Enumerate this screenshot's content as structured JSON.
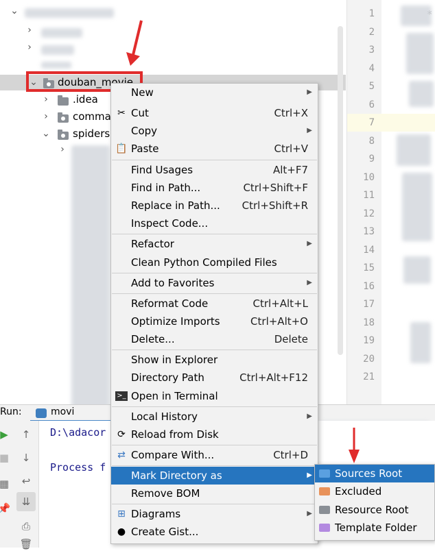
{
  "tree": {
    "selected_folder": "douban_movie",
    "children": [
      ".idea",
      "comma",
      "spiders"
    ]
  },
  "editor": {
    "line_numbers": [
      "1",
      "2",
      "3",
      "4",
      "5",
      "6",
      "7",
      "8",
      "9",
      "10",
      "11",
      "12",
      "13",
      "14",
      "15",
      "16",
      "17",
      "18",
      "19",
      "20",
      "21"
    ],
    "asterisk": "*"
  },
  "run": {
    "label": "Run:",
    "tab": "movi",
    "console_path": "D:\\adacor",
    "console_process": "Process f"
  },
  "context_menu": {
    "items": [
      {
        "label": "New",
        "shortcut": "",
        "submenu": true,
        "icon": ""
      },
      {
        "label": "Cut",
        "shortcut": "Ctrl+X",
        "submenu": false,
        "icon": "scissors-icon"
      },
      {
        "label": "Copy",
        "shortcut": "",
        "submenu": true,
        "icon": ""
      },
      {
        "label": "Paste",
        "shortcut": "Ctrl+V",
        "submenu": false,
        "icon": "clipboard-icon"
      },
      {
        "label": "Find Usages",
        "shortcut": "Alt+F7",
        "submenu": false,
        "icon": ""
      },
      {
        "label": "Find in Path...",
        "shortcut": "Ctrl+Shift+F",
        "submenu": false,
        "icon": ""
      },
      {
        "label": "Replace in Path...",
        "shortcut": "Ctrl+Shift+R",
        "submenu": false,
        "icon": ""
      },
      {
        "label": "Inspect Code...",
        "shortcut": "",
        "submenu": false,
        "icon": ""
      },
      {
        "label": "Refactor",
        "shortcut": "",
        "submenu": true,
        "icon": ""
      },
      {
        "label": "Clean Python Compiled Files",
        "shortcut": "",
        "submenu": false,
        "icon": ""
      },
      {
        "label": "Add to Favorites",
        "shortcut": "",
        "submenu": true,
        "icon": ""
      },
      {
        "label": "Reformat Code",
        "shortcut": "Ctrl+Alt+L",
        "submenu": false,
        "icon": ""
      },
      {
        "label": "Optimize Imports",
        "shortcut": "Ctrl+Alt+O",
        "submenu": false,
        "icon": ""
      },
      {
        "label": "Delete...",
        "shortcut": "Delete",
        "submenu": false,
        "icon": ""
      },
      {
        "label": "Show in Explorer",
        "shortcut": "",
        "submenu": false,
        "icon": ""
      },
      {
        "label": "Directory Path",
        "shortcut": "Ctrl+Alt+F12",
        "submenu": false,
        "icon": ""
      },
      {
        "label": "Open in Terminal",
        "shortcut": "",
        "submenu": false,
        "icon": "terminal-icon"
      },
      {
        "label": "Local History",
        "shortcut": "",
        "submenu": true,
        "icon": ""
      },
      {
        "label": "Reload from Disk",
        "shortcut": "",
        "submenu": false,
        "icon": "reload-icon"
      },
      {
        "label": "Compare With...",
        "shortcut": "Ctrl+D",
        "submenu": false,
        "icon": "compare-icon"
      },
      {
        "label": "Mark Directory as",
        "shortcut": "",
        "submenu": true,
        "icon": "",
        "highlighted": true
      },
      {
        "label": "Remove BOM",
        "shortcut": "",
        "submenu": false,
        "icon": ""
      },
      {
        "label": "Diagrams",
        "shortcut": "",
        "submenu": true,
        "icon": "diagram-icon"
      },
      {
        "label": "Create Gist...",
        "shortcut": "",
        "submenu": false,
        "icon": "github-icon"
      }
    ]
  },
  "mark_directory_submenu": {
    "items": [
      {
        "label": "Sources Root",
        "color": "#4a90d0",
        "highlighted": true
      },
      {
        "label": "Excluded",
        "color": "#e8925a"
      },
      {
        "label": "Resource Root",
        "color": "#8a8f95"
      },
      {
        "label": "Template Folder",
        "color": "#b38ae0"
      }
    ]
  },
  "colors": {
    "highlight": "#2675bf",
    "annotation_red": "#e02c2c"
  }
}
